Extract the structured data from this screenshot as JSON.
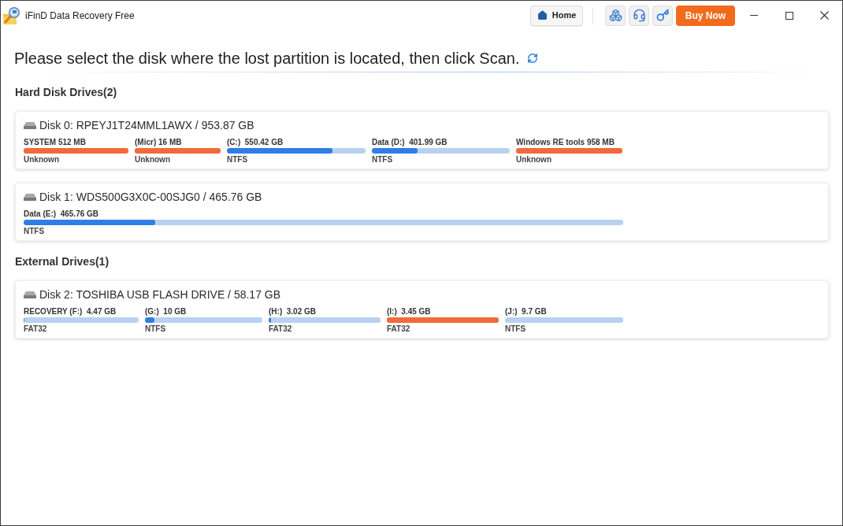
{
  "window": {
    "title": "iFinD Data Recovery Free"
  },
  "toolbar": {
    "home_button": "Home",
    "buy_button": "Buy Now"
  },
  "prompt": "Please select the disk where the lost partition is located, then click Scan.",
  "groups": [
    {
      "title": "Hard Disk Drives(2)",
      "disks": [
        {
          "name": "Disk 0: RPEYJ1T24MML1AWX / 953.87 GB",
          "partitions": [
            {
              "kind": "flagged",
              "label": "SYSTEM 512 MB",
              "filesystem": "Unknown",
              "color": "#f2693a"
            },
            {
              "kind": "flagged",
              "label": "(Micr) 16 MB",
              "filesystem": "Unknown",
              "color": "#f2693a"
            },
            {
              "kind": "usage",
              "label": "(C:)  550.42 GB",
              "filesystem": "NTFS",
              "level": 0.76,
              "color": "#2f7ee6"
            },
            {
              "kind": "usage",
              "label": "Data (D:)  401.99 GB",
              "filesystem": "NTFS",
              "level": 0.33,
              "color": "#2f7ee6"
            },
            {
              "kind": "flagged",
              "label": "Windows RE tools 958 MB",
              "filesystem": "Unknown",
              "color": "#f2693a"
            }
          ]
        },
        {
          "name": "Disk 1: WDS500G3X0C-00SJG0 / 465.76 GB",
          "partitions": [
            {
              "kind": "usage",
              "label": "Data (E:)  465.76 GB",
              "filesystem": "NTFS",
              "level": 0.22,
              "color": "#2f7ee6"
            }
          ]
        }
      ]
    },
    {
      "title": "External Drives(1)",
      "disks": [
        {
          "name": "Disk 2: TOSHIBA USB FLASH DRIVE / 58.17 GB",
          "partitions": [
            {
              "kind": "usage",
              "label": "RECOVERY (F:)  4.47 GB",
              "filesystem": "FAT32",
              "level": 0.01,
              "color": "#2f7ee6"
            },
            {
              "kind": "usage",
              "label": "(G:)  10 GB",
              "filesystem": "NTFS",
              "level": 0.08,
              "color": "#2f7ee6"
            },
            {
              "kind": "usage",
              "label": "(H:)  3.02 GB",
              "filesystem": "FAT32",
              "level": 0.02,
              "color": "#2f7ee6"
            },
            {
              "kind": "flagged",
              "label": "(I:)  3.45 GB",
              "filesystem": "FAT32",
              "color": "#f2693a"
            },
            {
              "kind": "usage",
              "label": "(J:)  9.7 GB",
              "filesystem": "NTFS"
            }
          ]
        }
      ]
    }
  ]
}
